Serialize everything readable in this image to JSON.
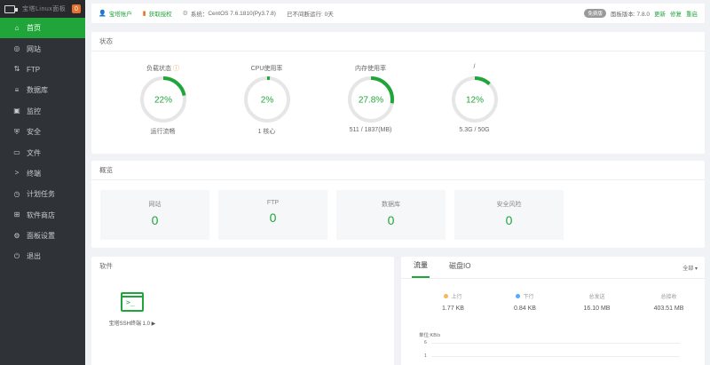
{
  "sidebar": {
    "logo_text": "宝塔Linux面板",
    "badge": "0",
    "items": [
      {
        "label": "首页",
        "icon": "home-icon",
        "glyph": "⌂"
      },
      {
        "label": "网站",
        "icon": "globe-icon",
        "glyph": "◎"
      },
      {
        "label": "FTP",
        "icon": "ftp-icon",
        "glyph": "⇅"
      },
      {
        "label": "数据库",
        "icon": "database-icon",
        "glyph": "≡"
      },
      {
        "label": "监控",
        "icon": "monitor-icon",
        "glyph": "▣"
      },
      {
        "label": "安全",
        "icon": "shield-icon",
        "glyph": "⛨"
      },
      {
        "label": "文件",
        "icon": "folder-icon",
        "glyph": "▭"
      },
      {
        "label": "终端",
        "icon": "terminal-icon",
        "glyph": ">"
      },
      {
        "label": "计划任务",
        "icon": "clock-icon",
        "glyph": "◷"
      },
      {
        "label": "软件商店",
        "icon": "store-icon",
        "glyph": "⊞"
      },
      {
        "label": "面板设置",
        "icon": "gear-icon",
        "glyph": "⚙"
      },
      {
        "label": "退出",
        "icon": "logout-icon",
        "glyph": "⏻"
      }
    ]
  },
  "topbar": {
    "user": "宝塔账户",
    "pro": "获取授权",
    "system_label": "系统：",
    "system_value": "CentOS 7.6.1810(Py3.7.8)",
    "uptime": "已不间断运行: 0天",
    "version_badge": "免费版",
    "version_label": "面板版本: 7.8.0",
    "links": [
      "更新",
      "修复",
      "重启"
    ]
  },
  "status": {
    "title": "状态",
    "gauges": [
      {
        "label": "负载状态",
        "value": "22%",
        "percent": 22,
        "sub": "运行流畅",
        "has_help": true
      },
      {
        "label": "CPU使用率",
        "value": "2%",
        "percent": 2,
        "sub": "1 核心",
        "has_help": false
      },
      {
        "label": "内存使用率",
        "value": "27.8%",
        "percent": 27.8,
        "sub": "511 / 1837(MB)",
        "has_help": false
      },
      {
        "label": "/",
        "value": "12%",
        "percent": 12,
        "sub": "5.3G / 50G",
        "has_help": false
      }
    ]
  },
  "overview": {
    "title": "概览",
    "cards": [
      {
        "label": "网站",
        "value": "0"
      },
      {
        "label": "FTP",
        "value": "0"
      },
      {
        "label": "数据库",
        "value": "0"
      },
      {
        "label": "安全风险",
        "value": "0"
      }
    ]
  },
  "software": {
    "title": "软件",
    "item_name": "宝塔SSH终端 1.0 ▶"
  },
  "traffic": {
    "tabs": [
      "流量",
      "磁盘IO"
    ],
    "select": "全部",
    "stats": [
      {
        "label": "上行",
        "value": "1.77 KB",
        "dot": "#f7b851"
      },
      {
        "label": "下行",
        "value": "0.84 KB",
        "dot": "#52a9ff"
      },
      {
        "label": "总发送",
        "value": "16.10 MB",
        "dot": null
      },
      {
        "label": "总接收",
        "value": "403.51 MB",
        "dot": null
      }
    ],
    "chart_unit": "单位:KB/s",
    "ticks": [
      "6",
      "1"
    ]
  },
  "colors": {
    "accent": "#20a53a",
    "sidebar": "#2f3338",
    "gauge_track": "#e6e6e6"
  }
}
